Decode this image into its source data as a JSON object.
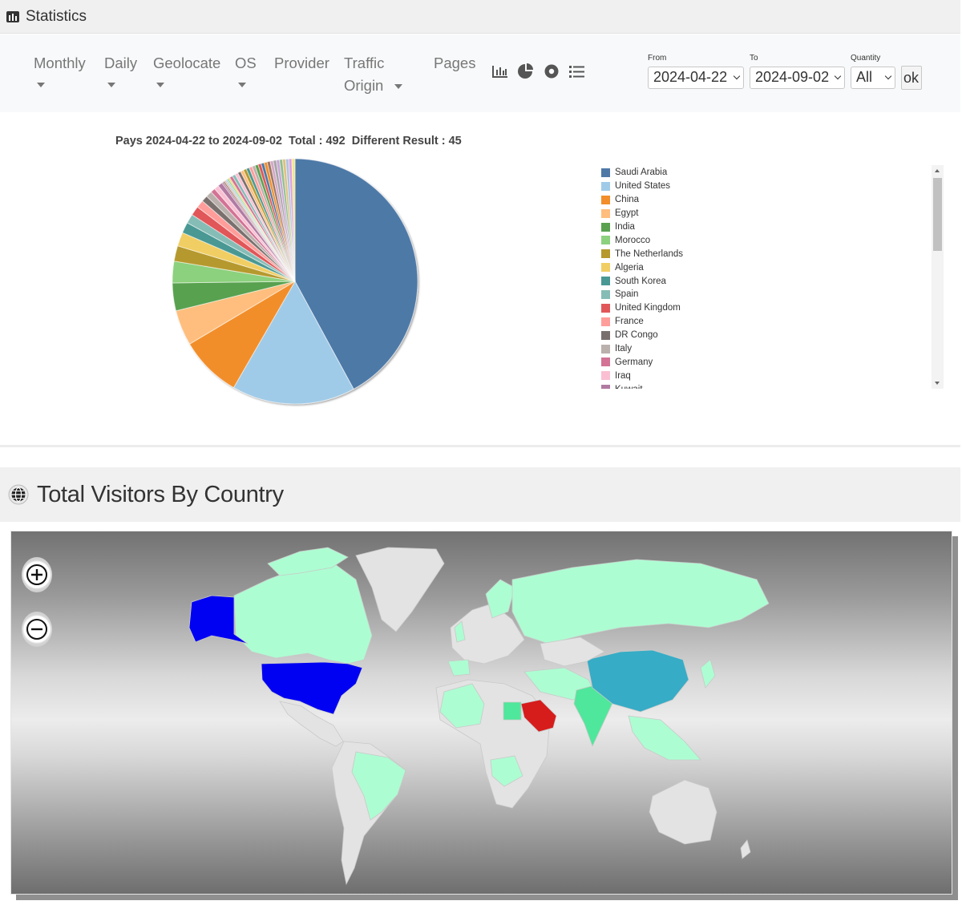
{
  "header": {
    "title": "Statistics",
    "icon": "bar-chart-icon"
  },
  "toolbar": {
    "menus": [
      {
        "label": "Monthly"
      },
      {
        "label": "Daily"
      },
      {
        "label": "Geolocate"
      },
      {
        "label": "OS"
      },
      {
        "label": "Provider"
      },
      {
        "label": "Traffic",
        "label2": "Origin"
      },
      {
        "label": "Pages"
      }
    ],
    "icons": [
      "bar-chart-icon",
      "pie-chart-icon",
      "donut-chart-icon",
      "list-icon"
    ],
    "from": {
      "label": "From",
      "value": "2024-04-22"
    },
    "to": {
      "label": "To",
      "value": "2024-09-02"
    },
    "quantity": {
      "label": "Quantity",
      "value": "All"
    },
    "ok_label": "ok"
  },
  "chart_data": {
    "type": "pie",
    "title": "Pays 2024-04-22 to 2024-09-02  Total : 492  Different Result : 45",
    "total": 492,
    "different_results": 45,
    "legend_position": "right",
    "categories": [
      "Saudi Arabia",
      "United States",
      "China",
      "Egypt",
      "India",
      "Morocco",
      "The Netherlands",
      "Algeria",
      "South Korea",
      "Spain",
      "United Kingdom",
      "France",
      "DR Congo",
      "Italy",
      "Germany",
      "Iraq",
      "Kuwait"
    ],
    "values": [
      207,
      80,
      40,
      23,
      18,
      14,
      10,
      9,
      7,
      6,
      6,
      5,
      4,
      4,
      3,
      3,
      3
    ],
    "other_slices": 28,
    "colors": [
      "#4e79a7",
      "#a0cbe8",
      "#f28e2b",
      "#ffbe7d",
      "#59a14f",
      "#8cd17d",
      "#b6992d",
      "#f1ce63",
      "#499894",
      "#86bcb6",
      "#e15759",
      "#ff9d9a",
      "#79706e",
      "#bab0ac",
      "#d37295",
      "#fabfd2",
      "#b07aa1"
    ]
  },
  "visitors": {
    "title": "Total Visitors By Country",
    "icon": "globe-icon",
    "zoom_in": "zoom-in-icon",
    "zoom_out": "zoom-out-icon",
    "map_colors": {
      "Saudi Arabia": "#d71c1c",
      "United States": "#0000f2",
      "China": "#36acc6",
      "India": "#4fe79b",
      "Egypt": "#4fe79b",
      "default_visited": "#adfdd2",
      "no_data": "#e3e3e3"
    }
  }
}
